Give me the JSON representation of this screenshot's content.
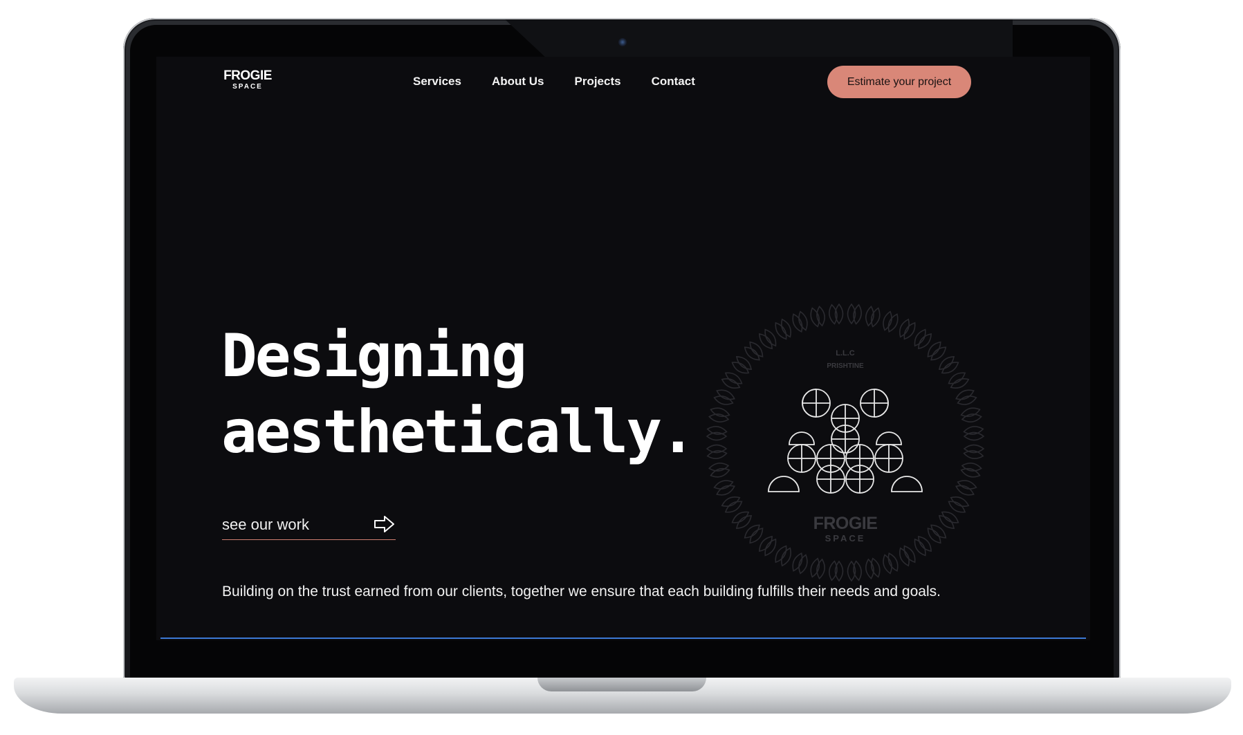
{
  "brand": {
    "name": "FROGIE",
    "sub": "SPACE"
  },
  "nav": {
    "items": [
      {
        "label": "Services"
      },
      {
        "label": "About Us"
      },
      {
        "label": "Projects"
      },
      {
        "label": "Contact"
      }
    ],
    "cta_label": "Estimate your project"
  },
  "hero": {
    "title_line1": "Designing",
    "title_line2": "aesthetically.",
    "link_label": "see our work",
    "link_icon": "arrow-right-icon",
    "tagline": "Building on the trust earned from our clients, together we ensure that each building fulfills their needs and goals."
  },
  "emblem": {
    "top_text_1": "L.L.C",
    "top_text_2": "PRISHTINE",
    "brand": "FROGIE",
    "brand_sub": "SPACE"
  },
  "colors": {
    "background": "#0c0c0f",
    "accent": "#d98778",
    "divider": "#3c7ad6",
    "text": "#ffffff"
  }
}
